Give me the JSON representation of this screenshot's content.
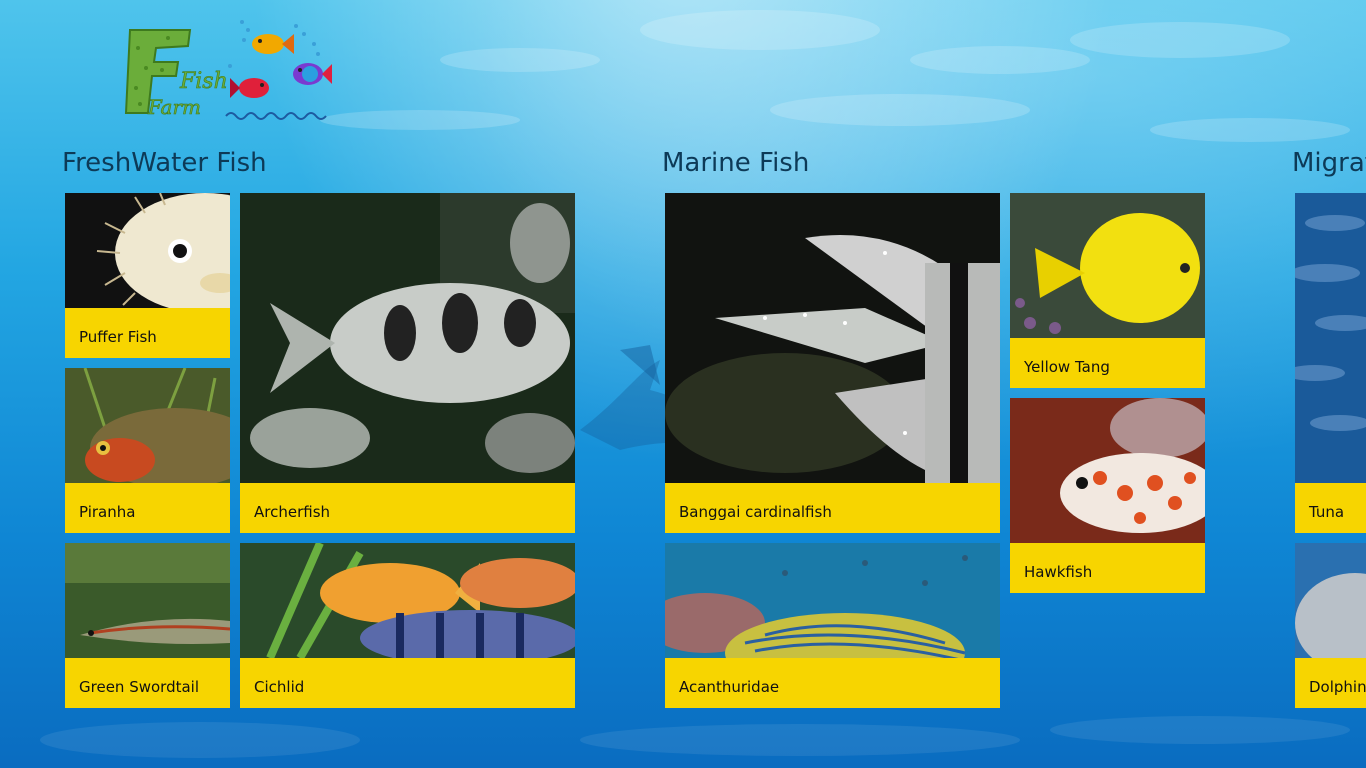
{
  "app": {
    "logo_text_top": "Fish",
    "logo_text_bottom": "Farm"
  },
  "groups": [
    {
      "title": "FreshWater Fish",
      "tiles": [
        {
          "label": "Puffer Fish"
        },
        {
          "label": "Archerfish"
        },
        {
          "label": "Piranha"
        },
        {
          "label": "Green Swordtail"
        },
        {
          "label": "Cichlid"
        }
      ]
    },
    {
      "title": "Marine Fish",
      "tiles": [
        {
          "label": "Banggai cardinalfish"
        },
        {
          "label": "Yellow Tang"
        },
        {
          "label": "Hawkfish"
        },
        {
          "label": "Acanthuridae"
        }
      ]
    },
    {
      "title": "Migrat",
      "tiles": [
        {
          "label": "Tuna"
        },
        {
          "label": "Dolphin"
        }
      ]
    }
  ],
  "colors": {
    "tile_label_bg": "#f7d500",
    "group_title": "#0d3a57",
    "water_top": "#4fc4ec",
    "water_bottom": "#0a6cc0"
  }
}
